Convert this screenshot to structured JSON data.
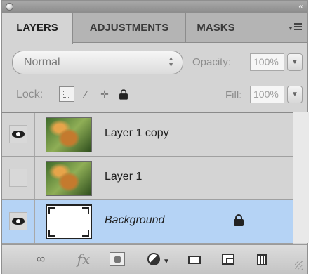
{
  "tabs": [
    {
      "label": "LAYERS",
      "active": true
    },
    {
      "label": "ADJUSTMENTS",
      "active": false
    },
    {
      "label": "MASKS",
      "active": false
    }
  ],
  "blend_mode": "Normal",
  "opacity": {
    "label": "Opacity:",
    "value": "100%"
  },
  "lock": {
    "label": "Lock:"
  },
  "fill": {
    "label": "Fill:",
    "value": "100%"
  },
  "layers": [
    {
      "name": "Layer 1 copy",
      "visible": true,
      "selected": false,
      "thumbnail": "image"
    },
    {
      "name": "Layer 1",
      "visible": false,
      "selected": false,
      "thumbnail": "image"
    },
    {
      "name": "Background",
      "visible": true,
      "selected": true,
      "thumbnail": "white",
      "locked": true
    }
  ],
  "icons": {
    "updown": "↕",
    "dropdown": "▼",
    "brush": "⁄",
    "move": "✛",
    "lock": "🔒",
    "link": "∞",
    "fx": "fx",
    "collapse": "«"
  },
  "colors": {
    "selected_row": "#b5d3f5",
    "panel_bg": "#d4d4d4"
  }
}
